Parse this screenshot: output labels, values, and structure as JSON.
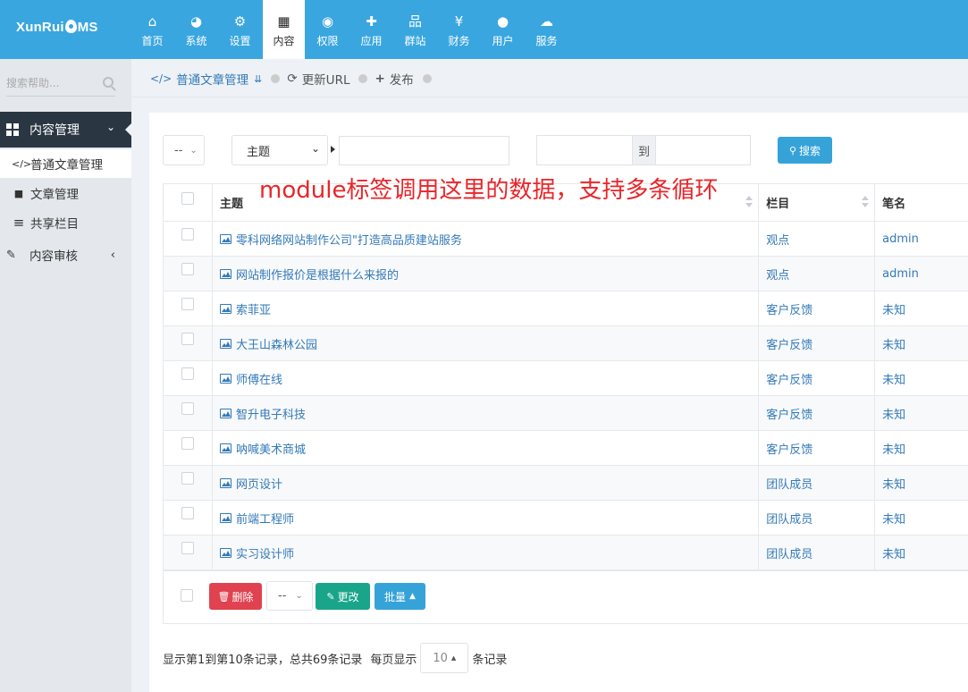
{
  "brand": {
    "logo_left": "XunRui",
    "logo_right": "MS"
  },
  "nav": [
    {
      "label": "首页",
      "icon": "home-icon",
      "glyph": "⌂"
    },
    {
      "label": "系统",
      "icon": "dashboard-icon",
      "glyph": "◕"
    },
    {
      "label": "设置",
      "icon": "cogs-icon",
      "glyph": "⚙"
    },
    {
      "label": "内容",
      "icon": "grid-icon",
      "glyph": "▦"
    },
    {
      "label": "权限",
      "icon": "user-circle-icon",
      "glyph": "◉"
    },
    {
      "label": "应用",
      "icon": "puzzle-icon",
      "glyph": "✚"
    },
    {
      "label": "群站",
      "icon": "sitemap-icon",
      "glyph": "品"
    },
    {
      "label": "财务",
      "icon": "yen-icon",
      "glyph": "¥"
    },
    {
      "label": "用户",
      "icon": "user-icon",
      "glyph": "●"
    },
    {
      "label": "服务",
      "icon": "cloud-icon",
      "glyph": "☁"
    }
  ],
  "sidebar": {
    "search_placeholder": "搜索帮助...",
    "group": "内容管理",
    "items": [
      {
        "label": "普通文章管理",
        "icon": "code-icon",
        "glyph": "</>"
      },
      {
        "label": "文章管理",
        "icon": "sticky-note-icon",
        "glyph": "■"
      },
      {
        "label": "共享栏目",
        "icon": "bars-icon",
        "glyph": "≡"
      }
    ],
    "audit": "内容审核"
  },
  "breadcrumb": {
    "current": "普通文章管理",
    "refresh": "更新URL",
    "publish": "发布"
  },
  "filters": {
    "select_default": "--",
    "field_select": "主题",
    "date_sep": "到",
    "search_button": "搜索"
  },
  "annotation": "module标签调用这里的数据，支持多条循环",
  "table": {
    "headers": {
      "title": "主题",
      "category": "栏目",
      "author": "笔名"
    },
    "rows": [
      {
        "title": "零科网络网站制作公司\"打造高品质建站服务",
        "category": "观点",
        "author": "admin"
      },
      {
        "title": "网站制作报价是根据什么来报的",
        "category": "观点",
        "author": "admin"
      },
      {
        "title": "索菲亚",
        "category": "客户反馈",
        "author": "未知"
      },
      {
        "title": "大王山森林公园",
        "category": "客户反馈",
        "author": "未知"
      },
      {
        "title": "师傅在线",
        "category": "客户反馈",
        "author": "未知"
      },
      {
        "title": "智升电子科技",
        "category": "客户反馈",
        "author": "未知"
      },
      {
        "title": "呐喊美术商城",
        "category": "客户反馈",
        "author": "未知"
      },
      {
        "title": "网页设计",
        "category": "团队成员",
        "author": "未知"
      },
      {
        "title": "前端工程师",
        "category": "团队成员",
        "author": "未知"
      },
      {
        "title": "实习设计师",
        "category": "团队成员",
        "author": "未知"
      }
    ]
  },
  "actions": {
    "delete": "删除",
    "select_default": "--",
    "change": "更改",
    "batch": "批量"
  },
  "pagination": {
    "summary": "显示第1到第10条记录，总共69条记录",
    "per_page_prefix": "每页显示",
    "per_page": "10",
    "per_page_suffix": "条记录"
  }
}
